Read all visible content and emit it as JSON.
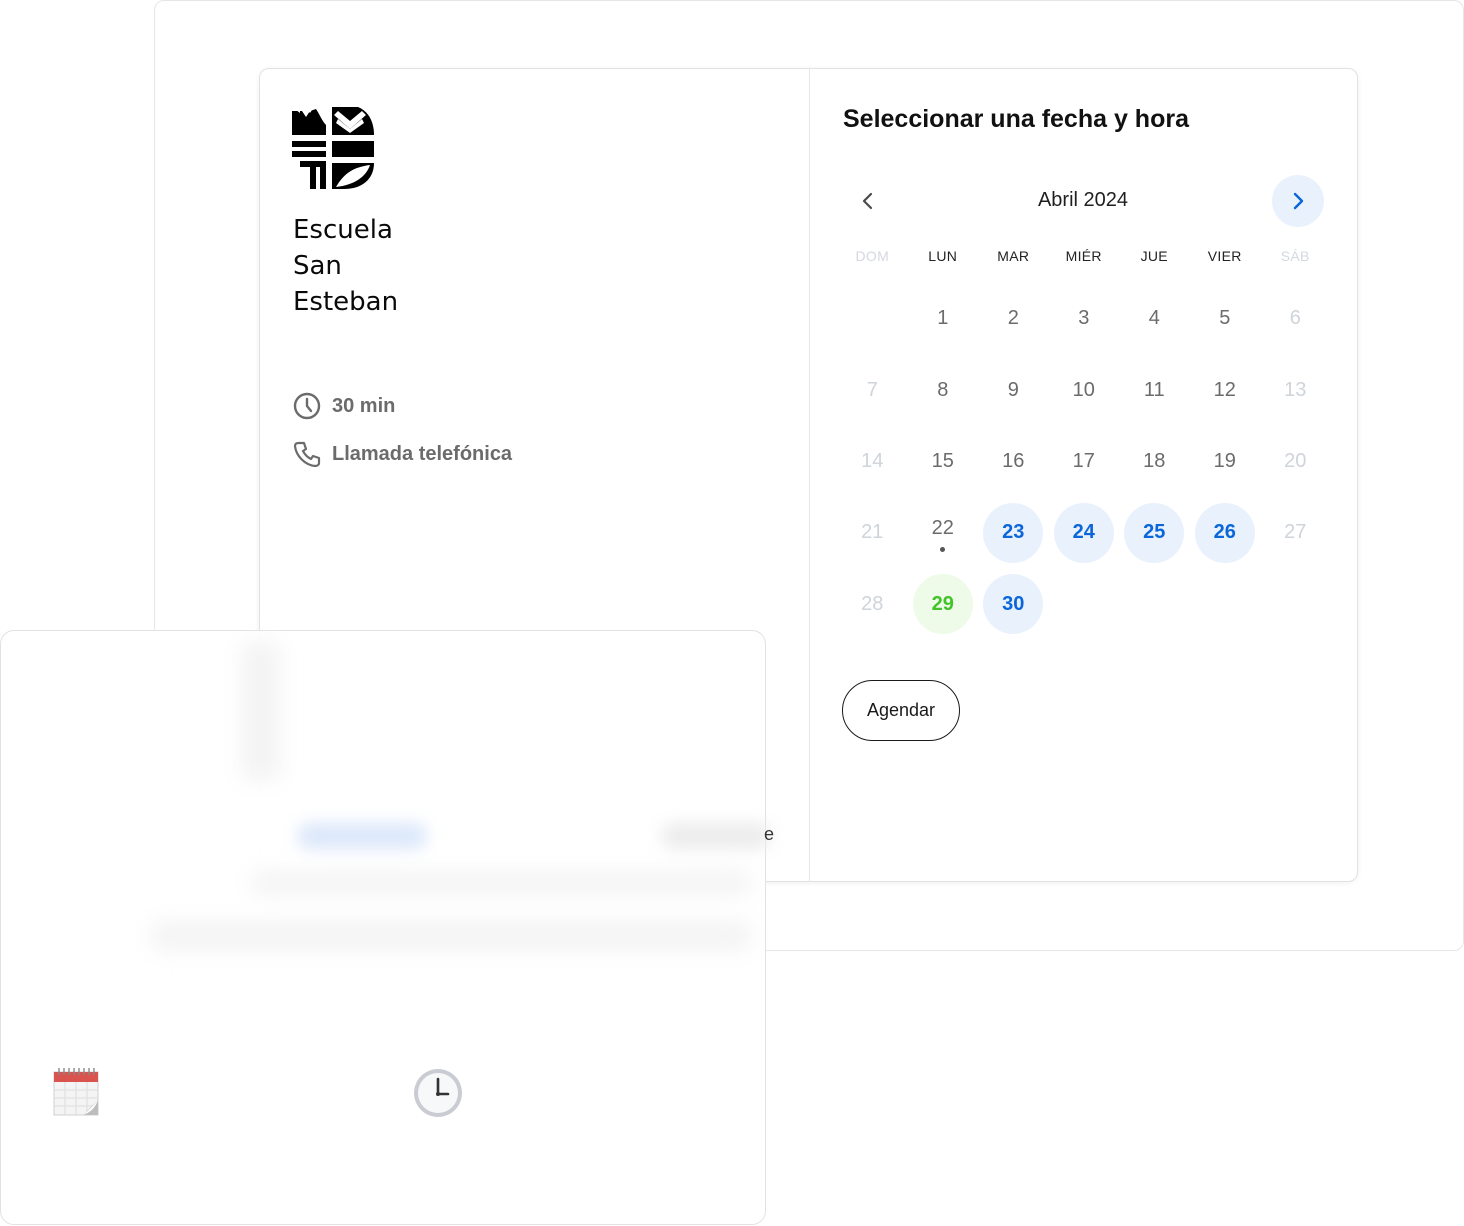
{
  "org": {
    "name_lines": [
      "Escuela",
      "San",
      "Esteban"
    ],
    "logo_icon": "school-crest-logo"
  },
  "event": {
    "duration": "30 min",
    "duration_icon": "clock-icon",
    "location": "Llamada telefónica",
    "location_icon": "phone-icon"
  },
  "calendar": {
    "title": "Seleccionar una fecha y hora",
    "month_label": "Abril 2024",
    "weekdays": [
      {
        "label": "DOM",
        "off": true
      },
      {
        "label": "LUN",
        "off": false
      },
      {
        "label": "MAR",
        "off": false
      },
      {
        "label": "MIÉR",
        "off": false
      },
      {
        "label": "JUE",
        "off": false
      },
      {
        "label": "VIER",
        "off": false
      },
      {
        "label": "SÁB",
        "off": true
      }
    ],
    "days": [
      {
        "n": ""
      },
      {
        "n": "1"
      },
      {
        "n": "2"
      },
      {
        "n": "3"
      },
      {
        "n": "4"
      },
      {
        "n": "5"
      },
      {
        "n": "6",
        "state": "off"
      },
      {
        "n": "7",
        "state": "off"
      },
      {
        "n": "8"
      },
      {
        "n": "9"
      },
      {
        "n": "10"
      },
      {
        "n": "11"
      },
      {
        "n": "12"
      },
      {
        "n": "13",
        "state": "off"
      },
      {
        "n": "14",
        "state": "off"
      },
      {
        "n": "15"
      },
      {
        "n": "16"
      },
      {
        "n": "17"
      },
      {
        "n": "18"
      },
      {
        "n": "19"
      },
      {
        "n": "20",
        "state": "off"
      },
      {
        "n": "21",
        "state": "off"
      },
      {
        "n": "22",
        "state": "dot"
      },
      {
        "n": "23",
        "state": "avail"
      },
      {
        "n": "24",
        "state": "avail"
      },
      {
        "n": "25",
        "state": "avail"
      },
      {
        "n": "26",
        "state": "avail"
      },
      {
        "n": "27",
        "state": "off"
      },
      {
        "n": "28",
        "state": "off"
      },
      {
        "n": "29",
        "state": "today"
      },
      {
        "n": "30",
        "state": "avail"
      }
    ],
    "colors": {
      "available_bg": "#e9f1fd",
      "available_text": "#0a66d9",
      "today_bg": "#eefbe9",
      "today_text": "#44c22c",
      "disabled_text": "#cfd4da"
    },
    "schedule_button_label": "Agendar"
  },
  "overlay": {
    "stray_text": "e",
    "calendar_icon": "calendar-emoji-icon",
    "clock_icon": "clock-emoji-icon"
  }
}
